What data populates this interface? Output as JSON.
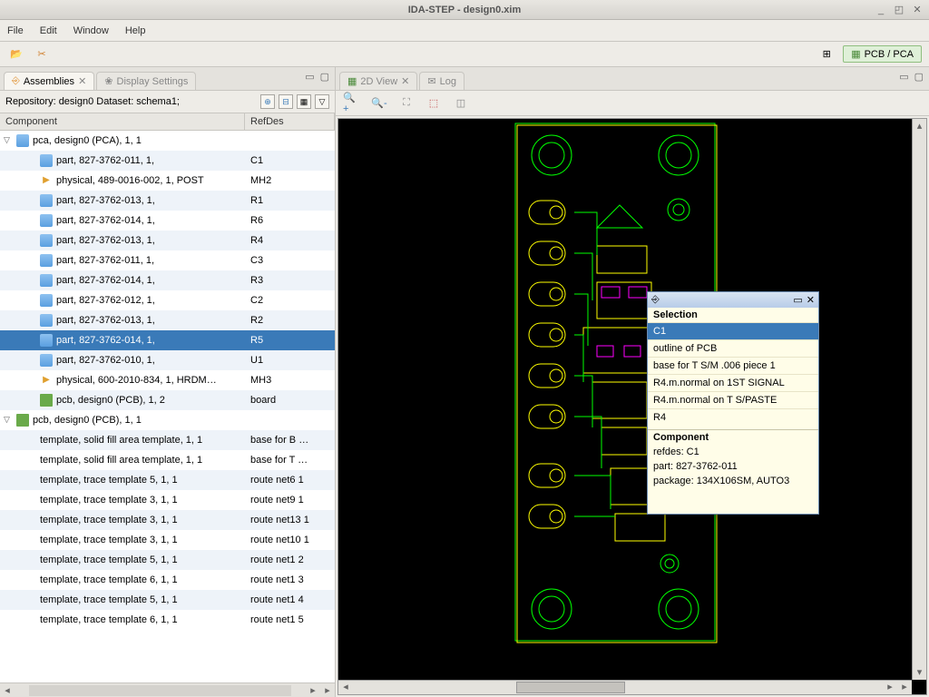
{
  "window": {
    "title": "IDA-STEP - design0.xim"
  },
  "menu": {
    "file": "File",
    "edit": "Edit",
    "window": "Window",
    "help": "Help"
  },
  "perspective": {
    "label": "PCB / PCA"
  },
  "left_panel": {
    "tabs": {
      "assemblies": "Assemblies",
      "display": "Display Settings"
    },
    "repo": "Repository: design0 Dataset: schema1;",
    "columns": {
      "component": "Component",
      "refdes": "RefDes"
    },
    "rows": [
      {
        "lvl": 0,
        "twisty": "▽",
        "icon": "cube",
        "comp": "pca, design0 (PCA), 1, 1",
        "ref": ""
      },
      {
        "lvl": 2,
        "icon": "cube",
        "comp": "part, 827-3762-011, 1,",
        "ref": "C1",
        "alt": true
      },
      {
        "lvl": 2,
        "icon": "play",
        "comp": "physical, 489-0016-002, 1, POST",
        "ref": "MH2"
      },
      {
        "lvl": 2,
        "icon": "cube",
        "comp": "part, 827-3762-013, 1,",
        "ref": "R1",
        "alt": true
      },
      {
        "lvl": 2,
        "icon": "cube",
        "comp": "part, 827-3762-014, 1,",
        "ref": "R6"
      },
      {
        "lvl": 2,
        "icon": "cube",
        "comp": "part, 827-3762-013, 1,",
        "ref": "R4",
        "alt": true
      },
      {
        "lvl": 2,
        "icon": "cube",
        "comp": "part, 827-3762-011, 1,",
        "ref": "C3"
      },
      {
        "lvl": 2,
        "icon": "cube",
        "comp": "part, 827-3762-014, 1,",
        "ref": "R3",
        "alt": true
      },
      {
        "lvl": 2,
        "icon": "cube",
        "comp": "part, 827-3762-012, 1,",
        "ref": "C2"
      },
      {
        "lvl": 2,
        "icon": "cube",
        "comp": "part, 827-3762-013, 1,",
        "ref": "R2",
        "alt": true
      },
      {
        "lvl": 2,
        "icon": "cube",
        "comp": "part, 827-3762-014, 1,",
        "ref": "R5",
        "selected": true
      },
      {
        "lvl": 2,
        "icon": "cube",
        "comp": "part, 827-3762-010, 1,",
        "ref": "U1",
        "alt": true
      },
      {
        "lvl": 2,
        "icon": "play",
        "comp": "physical, 600-2010-834, 1, HRDM…",
        "ref": "MH3"
      },
      {
        "lvl": 2,
        "icon": "pcb",
        "comp": "pcb, design0 (PCB), 1, 2",
        "ref": "board",
        "alt": true
      },
      {
        "lvl": 0,
        "twisty": "▽",
        "icon": "pcb",
        "comp": "pcb, design0 (PCB), 1, 1",
        "ref": ""
      },
      {
        "lvl": 2,
        "comp": "template, solid fill area template, 1, 1",
        "ref": "base for B …",
        "alt": true
      },
      {
        "lvl": 2,
        "comp": "template, solid fill area template, 1, 1",
        "ref": "base for T …"
      },
      {
        "lvl": 2,
        "comp": "template, trace template 5, 1, 1",
        "ref": "route net6 1",
        "alt": true
      },
      {
        "lvl": 2,
        "comp": "template, trace template 3, 1, 1",
        "ref": "route net9 1"
      },
      {
        "lvl": 2,
        "comp": "template, trace template 3, 1, 1",
        "ref": "route net13 1",
        "alt": true
      },
      {
        "lvl": 2,
        "comp": "template, trace template 3, 1, 1",
        "ref": "route net10 1"
      },
      {
        "lvl": 2,
        "comp": "template, trace template 5, 1, 1",
        "ref": "route net1 2",
        "alt": true
      },
      {
        "lvl": 2,
        "comp": "template, trace template 6, 1, 1",
        "ref": "route net1 3"
      },
      {
        "lvl": 2,
        "comp": "template, trace template 5, 1, 1",
        "ref": "route net1 4",
        "alt": true
      },
      {
        "lvl": 2,
        "comp": "template, trace template 6, 1, 1",
        "ref": "route net1 5"
      }
    ]
  },
  "right_panel": {
    "tabs": {
      "view2d": "2D View",
      "log": "Log"
    }
  },
  "popup": {
    "title": "Selection",
    "items": [
      {
        "label": "C1",
        "sel": true
      },
      {
        "label": "outline of PCB"
      },
      {
        "label": "base for T S/M .006 piece 1"
      },
      {
        "label": "R4.m.normal on 1ST SIGNAL"
      },
      {
        "label": "R4.m.normal on T S/PASTE"
      },
      {
        "label": "R4"
      }
    ],
    "component_head": "Component",
    "details": {
      "refdes": "refdes: C1",
      "part": "part: 827-3762-011",
      "package": "package: 134X106SM, AUTO3"
    }
  }
}
